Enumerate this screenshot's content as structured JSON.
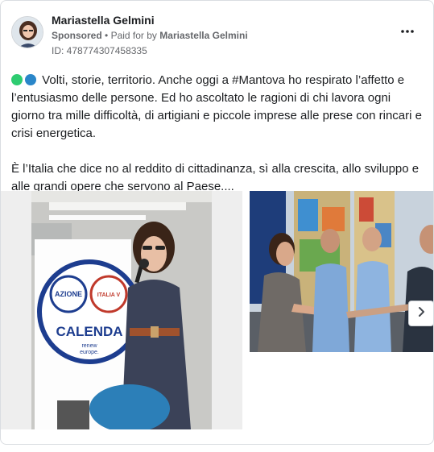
{
  "advertiser": {
    "name": "Mariastella Gelmini",
    "sponsored": "Sponsored",
    "separator": "•",
    "paid_for_prefix": "Paid for by",
    "paid_for_name": "Mariastella Gelmini",
    "id_text": "ID: 478774307458335"
  },
  "post": {
    "paragraph1": "Volti, storie, territorio. Anche oggi a #Mantova ho respirato l’affetto e l’entusiasmo delle persone. Ed ho ascoltato le ragioni di chi lavora ogni giorno tra mille difficoltà, di artigiani e piccole imprese alle prese con rincari e crisi energetica.",
    "paragraph2": "È l’Italia che dice no al reddito di cittadinanza, sì alla crescita, allo sviluppo e alle grandi opere che servono al Paese...."
  },
  "photo_main": {
    "logo_left": "AZIONE",
    "logo_right": "ITALIA V",
    "logo_word": "CALENDA",
    "logo_sub1": "renew",
    "logo_sub2": "europe."
  },
  "icons": {
    "more": "more-options-icon",
    "next": "chevron-right-icon"
  },
  "colors": {
    "green_dot": "#2ecc71",
    "blue_dot": "#2a86c9",
    "calenda_blue": "#1d3d8f"
  }
}
